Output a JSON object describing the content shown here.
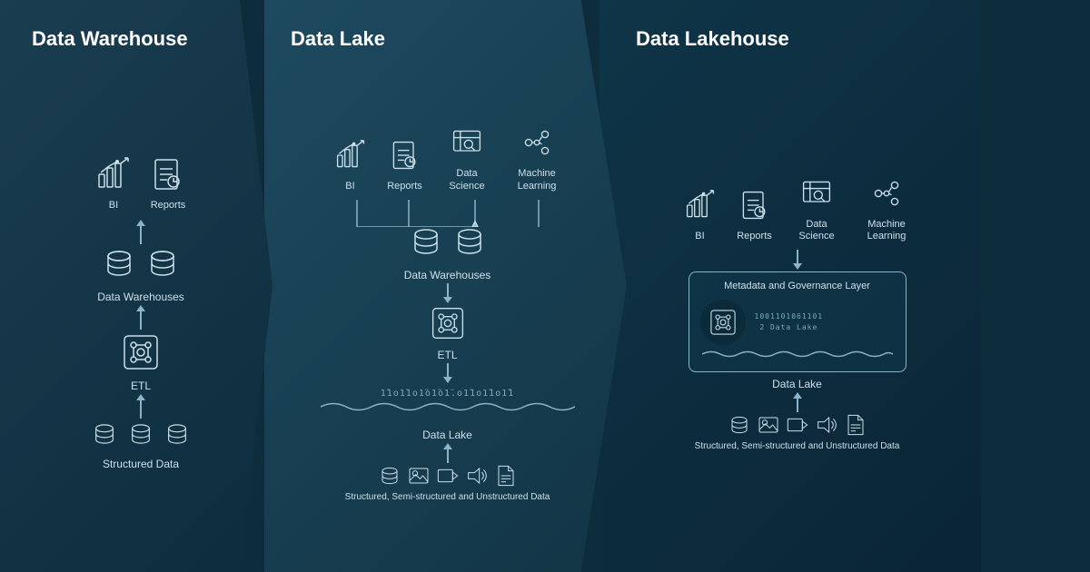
{
  "sections": [
    {
      "id": "warehouse",
      "title": "Data Warehouse",
      "consumers": [
        "BI",
        "Reports"
      ],
      "layer1": "Data Warehouses",
      "layer2": "ETL",
      "layer3": "Structured Data"
    },
    {
      "id": "lake",
      "title": "Data Lake",
      "consumers": [
        "BI",
        "Reports",
        "Data Science",
        "Machine Learning"
      ],
      "layer1": "Data Warehouses",
      "layer2": "ETL",
      "layer3": "Data Lake",
      "layer4": "Structured, Semi-structured and Unstructured Data"
    },
    {
      "id": "lakehouse",
      "title": "Data Lakehouse",
      "consumers": [
        "BI",
        "Reports",
        "Data Science",
        "Machine Learning"
      ],
      "gov_label": "Metadata and Governance Layer",
      "lake_label": "Data Lake",
      "layer4": "Structured, Semi-structured and Unstructured Data"
    }
  ]
}
